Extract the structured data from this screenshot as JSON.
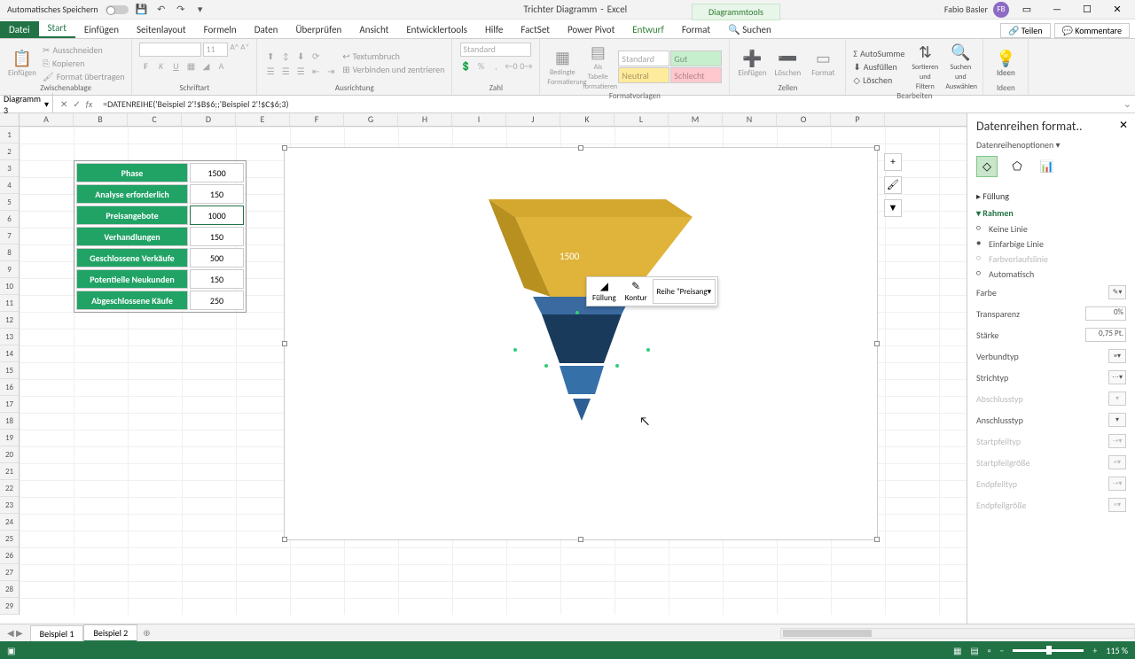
{
  "titlebar": {
    "autosave": "Automatisches Speichern",
    "doc_title": "Trichter Diagramm",
    "app_name": "Excel",
    "tools_tab": "Diagrammtools",
    "user": "Fabio Basler",
    "user_initials": "FB"
  },
  "tabs": {
    "file": "Datei",
    "start": "Start",
    "insert": "Einfügen",
    "layout": "Seitenlayout",
    "formulas": "Formeln",
    "data": "Daten",
    "review": "Überprüfen",
    "view": "Ansicht",
    "dev": "Entwicklertools",
    "help": "Hilfe",
    "factset": "FactSet",
    "powerpivot": "Power Pivot",
    "design": "Entwurf",
    "format": "Format",
    "search": "Suchen",
    "share": "Teilen",
    "comments": "Kommentare"
  },
  "ribbon": {
    "clipboard": {
      "paste": "Einfügen",
      "cut": "Ausschneiden",
      "copy": "Kopieren",
      "painter": "Format übertragen",
      "label": "Zwischenablage"
    },
    "font": {
      "size": "11",
      "label": "Schriftart"
    },
    "align": {
      "wrap": "Textumbruch",
      "merge": "Verbinden und zentrieren",
      "label": "Ausrichtung"
    },
    "number": {
      "fmt": "Standard",
      "label": "Zahl"
    },
    "styles": {
      "cond": "Bedingte Formatierung",
      "table": "Als Tabelle formatieren",
      "std": "Standard",
      "gut": "Gut",
      "neu": "Neutral",
      "sch": "Schlecht",
      "label": "Formatvorlagen"
    },
    "cells": {
      "ins": "Einfügen",
      "del": "Löschen",
      "fmt": "Format",
      "label": "Zellen"
    },
    "edit": {
      "sum": "AutoSumme",
      "fill": "Ausfüllen",
      "clear": "Löschen",
      "sort": "Sortieren und Filtern",
      "find": "Suchen und Auswählen",
      "label": "Bearbeiten"
    },
    "ideas": {
      "btn": "Ideen",
      "label": "Ideen"
    }
  },
  "namebox": "Diagramm 3",
  "formula": "=DATENREIHE('Beispiel 2'!$B$6;;'Beispiel 2'!$C$6;3)",
  "columns": [
    "A",
    "B",
    "C",
    "D",
    "E",
    "F",
    "G",
    "H",
    "I",
    "J",
    "K",
    "L",
    "M",
    "N",
    "O",
    "P"
  ],
  "table_data": [
    {
      "label": "Phase",
      "value": "1500"
    },
    {
      "label": "Analyse erforderlich",
      "value": "150"
    },
    {
      "label": "Preisangebote",
      "value": "1000"
    },
    {
      "label": "Verhandlungen",
      "value": "150"
    },
    {
      "label": "Geschlossene Verkäufe",
      "value": "500"
    },
    {
      "label": "Potentielle Neukunden",
      "value": "150"
    },
    {
      "label": "Abgeschlossene Käufe",
      "value": "250"
    }
  ],
  "chart_data": {
    "type": "funnel-3d",
    "categories": [
      "Phase",
      "Analyse erforderlich",
      "Preisangebote",
      "Verhandlungen",
      "Geschlossene Verkäufe",
      "Potentielle Neukunden",
      "Abgeschlossene Käufe"
    ],
    "values": [
      1500,
      150,
      1000,
      150,
      500,
      150,
      250
    ],
    "data_label_shown": "1500",
    "selected_series": "Preisangebote"
  },
  "mini_toolbar": {
    "fill": "Füllung",
    "outline": "Kontur",
    "series": "Reihe \"Preisang"
  },
  "format_pane": {
    "title": "Datenreihen format..",
    "sub": "Datenreihenoptionen",
    "fill_section": "Füllung",
    "border_section": "Rahmen",
    "no_line": "Keine Linie",
    "solid_line": "Einfarbige Linie",
    "grad_line": "Farbverlaufslinie",
    "auto": "Automatisch",
    "color": "Farbe",
    "transp": "Transparenz",
    "transp_val": "0%",
    "width": "Stärke",
    "width_val": "0,75 Pt.",
    "compound": "Verbundtyp",
    "dash": "Strichtyp",
    "cap": "Abschlusstyp",
    "join": "Anschlusstyp",
    "arrow_start": "Startpfeiltyp",
    "arrow_start_sz": "Startpfeilgröße",
    "arrow_end": "Endpfeiltyp",
    "arrow_end_sz": "Endpfeilgröße"
  },
  "sheets": {
    "s1": "Beispiel 1",
    "s2": "Beispiel 2"
  },
  "status": {
    "zoom": "115 %"
  }
}
